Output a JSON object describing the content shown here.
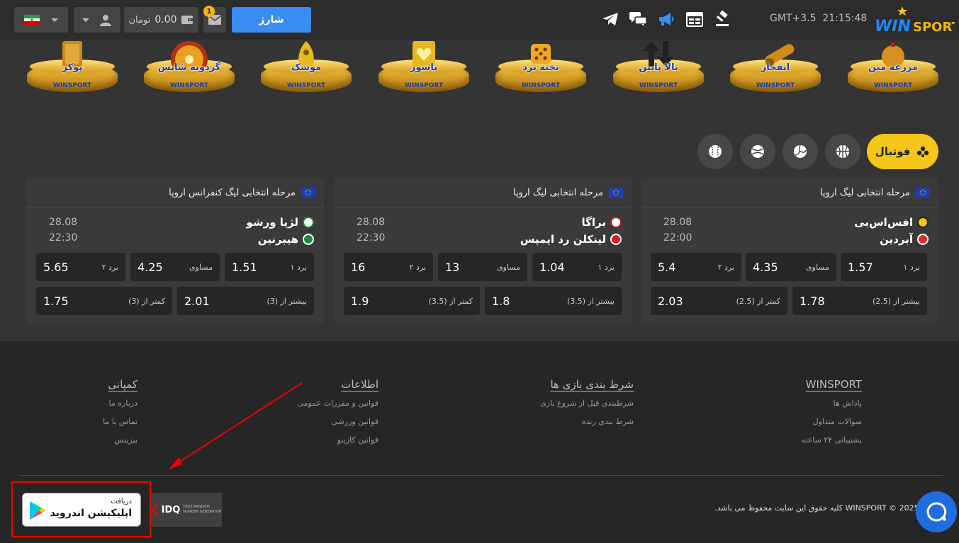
{
  "header": {
    "charge_label": "شارژ",
    "balance": "0.00",
    "currency": "تومان",
    "notification_count": "1",
    "time": "21:15:48",
    "timezone": "GMT+3.5",
    "brand": "WINSPORT",
    "language_flag": "iran-flag-icon",
    "nav_icons": [
      "telegram-icon",
      "chat-bubbles-icon",
      "megaphone-icon",
      "schedule-icon",
      "auction-hammer-icon"
    ]
  },
  "games": [
    {
      "name": "پوکر",
      "logo": "WINSPORT"
    },
    {
      "name": "گردونه شانس",
      "logo": "WINSPORT"
    },
    {
      "name": "موشک",
      "logo": "WINSPORT"
    },
    {
      "name": "پاسور",
      "logo": "WINSPORT"
    },
    {
      "name": "تخته نرد",
      "logo": "WINSPORT"
    },
    {
      "name": "بالا پایین",
      "logo": "WINSPORT"
    },
    {
      "name": "انفجار",
      "logo": "WINSPORT"
    },
    {
      "name": "مزرعه مین",
      "logo": "WINSPORT"
    }
  ],
  "sports": {
    "active_label": "فوتبال",
    "icons": [
      "football-icon",
      "basketball-icon",
      "volleyball-icon",
      "tennis-icon",
      "baseball-icon"
    ]
  },
  "matches": [
    {
      "league": "مرحله انتخابی لیگ اروپا",
      "home": "افس‌اس‌بی",
      "away": "آبردین",
      "date": "28.08",
      "time": "22:00",
      "odds": [
        {
          "label": "برد ۱",
          "value": "1.57"
        },
        {
          "label": "مساوی",
          "value": "4.35"
        },
        {
          "label": "برد ۲",
          "value": "5.4"
        },
        {
          "label": "بیشتر از (2.5)",
          "value": "1.78"
        },
        {
          "label": "کمتر از (2.5)",
          "value": "2.03"
        }
      ]
    },
    {
      "league": "مرحله انتخابی لیگ اروپا",
      "home": "براگا",
      "away": "لینکلن رد ایمپس",
      "date": "28.08",
      "time": "22:30",
      "odds": [
        {
          "label": "برد ۱",
          "value": "1.04"
        },
        {
          "label": "مساوی",
          "value": "13"
        },
        {
          "label": "برد ۲",
          "value": "16"
        },
        {
          "label": "بیشتر از (3.5)",
          "value": "1.8"
        },
        {
          "label": "کمتر از (3.5)",
          "value": "1.9"
        }
      ]
    },
    {
      "league": "مرحله انتخابی لیگ کنفرانس اروپا",
      "home": "لژیا ورشو",
      "away": "هیبرنین",
      "date": "28.08",
      "time": "22:30",
      "odds": [
        {
          "label": "برد ۱",
          "value": "1.51"
        },
        {
          "label": "مساوی",
          "value": "4.25"
        },
        {
          "label": "برد ۲",
          "value": "5.65"
        },
        {
          "label": "بیشتر از (3)",
          "value": "2.01"
        },
        {
          "label": "کمتر از (3)",
          "value": "1.75"
        }
      ]
    }
  ],
  "footer": {
    "columns": [
      {
        "title": "WINSPORT",
        "links": [
          "پاداش ها",
          "سوالات متداول",
          "پشتیبانی ۲۴ ساعته"
        ]
      },
      {
        "title": "شرط بندی بازی ها",
        "links": [
          "شرطبندی قبل از شروع بازی",
          "شرط بندی زنده"
        ]
      },
      {
        "title": "اطلاعات",
        "links": [
          "قوانین و مقررات عمومی",
          "قوانین ورزشی",
          "قوانین کازینو"
        ]
      },
      {
        "title": "کمپانی",
        "links": [
          "درباره ما",
          "تماس با ما",
          "بیزینس"
        ]
      }
    ],
    "copyright": "2025 © WINSPORT کلیه حقوق این سایت محفوظ می باشد.",
    "android_small": "دریافت",
    "android_big": "اپلیکیشن اندروید",
    "idq_brand": "IDQ",
    "idq_sub1": "TRUE RANDOM",
    "idq_sub2": "NUMBER GENERATOR"
  }
}
